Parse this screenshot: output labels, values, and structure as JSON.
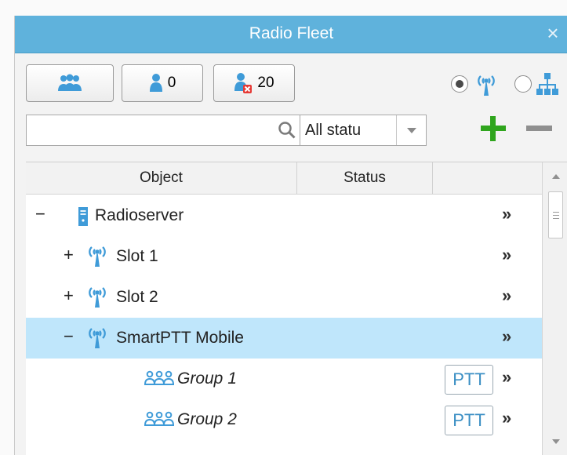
{
  "window": {
    "title": "Radio Fleet"
  },
  "toolbar": {
    "groups_button": {
      "icon": "group-users-icon"
    },
    "online_button": {
      "count": "0",
      "icon": "user-icon"
    },
    "offline_button": {
      "count": "20",
      "icon": "user-offline-icon"
    },
    "view_mode": {
      "selected": "radio-tree",
      "options": [
        {
          "icon": "radio-antenna-icon"
        },
        {
          "icon": "hierarchy-icon"
        }
      ]
    }
  },
  "search": {
    "placeholder": "",
    "value": ""
  },
  "status_filter": {
    "selected": "All statu"
  },
  "grid": {
    "columns": [
      {
        "label": "Object"
      },
      {
        "label": "Status"
      },
      {
        "label": ""
      }
    ],
    "rows": [
      {
        "expander": "−",
        "icon": "server-icon",
        "label": "Radioserver",
        "selected": false,
        "ptt": "",
        "chevron": "»"
      },
      {
        "expander": "+",
        "icon": "radio-antenna-icon",
        "label": "Slot 1",
        "selected": false,
        "ptt": "",
        "chevron": "»"
      },
      {
        "expander": "+",
        "icon": "radio-antenna-icon",
        "label": "Slot 2",
        "selected": false,
        "ptt": "",
        "chevron": "»"
      },
      {
        "expander": "−",
        "icon": "radio-antenna-icon",
        "label": "SmartPTT Mobile",
        "selected": true,
        "ptt": "",
        "chevron": "»"
      },
      {
        "expander": "",
        "icon": "group-users-icon",
        "label": "Group 1",
        "selected": false,
        "ptt": "PTT",
        "chevron": "»"
      },
      {
        "expander": "",
        "icon": "group-users-icon",
        "label": "Group 2",
        "selected": false,
        "ptt": "PTT",
        "chevron": "»"
      }
    ]
  },
  "colors": {
    "titlebar": "#5fb2dc",
    "selection": "#bfe6fb",
    "accent_blue": "#3f9bd8",
    "add_green": "#2fa51d",
    "offline_red": "#e53935"
  }
}
